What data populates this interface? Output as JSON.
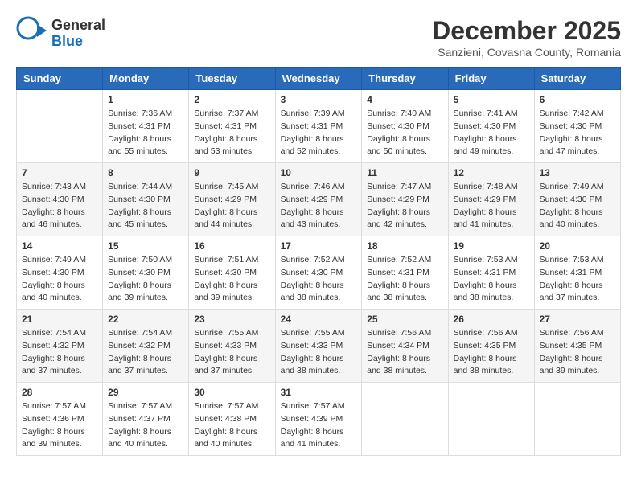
{
  "header": {
    "logo_general": "General",
    "logo_blue": "Blue",
    "month_title": "December 2025",
    "location": "Sanzieni, Covasna County, Romania"
  },
  "weekdays": [
    "Sunday",
    "Monday",
    "Tuesday",
    "Wednesday",
    "Thursday",
    "Friday",
    "Saturday"
  ],
  "weeks": [
    [
      {
        "day": "",
        "info": ""
      },
      {
        "day": "1",
        "info": "Sunrise: 7:36 AM\nSunset: 4:31 PM\nDaylight: 8 hours\nand 55 minutes."
      },
      {
        "day": "2",
        "info": "Sunrise: 7:37 AM\nSunset: 4:31 PM\nDaylight: 8 hours\nand 53 minutes."
      },
      {
        "day": "3",
        "info": "Sunrise: 7:39 AM\nSunset: 4:31 PM\nDaylight: 8 hours\nand 52 minutes."
      },
      {
        "day": "4",
        "info": "Sunrise: 7:40 AM\nSunset: 4:30 PM\nDaylight: 8 hours\nand 50 minutes."
      },
      {
        "day": "5",
        "info": "Sunrise: 7:41 AM\nSunset: 4:30 PM\nDaylight: 8 hours\nand 49 minutes."
      },
      {
        "day": "6",
        "info": "Sunrise: 7:42 AM\nSunset: 4:30 PM\nDaylight: 8 hours\nand 47 minutes."
      }
    ],
    [
      {
        "day": "7",
        "info": "Sunrise: 7:43 AM\nSunset: 4:30 PM\nDaylight: 8 hours\nand 46 minutes."
      },
      {
        "day": "8",
        "info": "Sunrise: 7:44 AM\nSunset: 4:30 PM\nDaylight: 8 hours\nand 45 minutes."
      },
      {
        "day": "9",
        "info": "Sunrise: 7:45 AM\nSunset: 4:29 PM\nDaylight: 8 hours\nand 44 minutes."
      },
      {
        "day": "10",
        "info": "Sunrise: 7:46 AM\nSunset: 4:29 PM\nDaylight: 8 hours\nand 43 minutes."
      },
      {
        "day": "11",
        "info": "Sunrise: 7:47 AM\nSunset: 4:29 PM\nDaylight: 8 hours\nand 42 minutes."
      },
      {
        "day": "12",
        "info": "Sunrise: 7:48 AM\nSunset: 4:29 PM\nDaylight: 8 hours\nand 41 minutes."
      },
      {
        "day": "13",
        "info": "Sunrise: 7:49 AM\nSunset: 4:30 PM\nDaylight: 8 hours\nand 40 minutes."
      }
    ],
    [
      {
        "day": "14",
        "info": "Sunrise: 7:49 AM\nSunset: 4:30 PM\nDaylight: 8 hours\nand 40 minutes."
      },
      {
        "day": "15",
        "info": "Sunrise: 7:50 AM\nSunset: 4:30 PM\nDaylight: 8 hours\nand 39 minutes."
      },
      {
        "day": "16",
        "info": "Sunrise: 7:51 AM\nSunset: 4:30 PM\nDaylight: 8 hours\nand 39 minutes."
      },
      {
        "day": "17",
        "info": "Sunrise: 7:52 AM\nSunset: 4:30 PM\nDaylight: 8 hours\nand 38 minutes."
      },
      {
        "day": "18",
        "info": "Sunrise: 7:52 AM\nSunset: 4:31 PM\nDaylight: 8 hours\nand 38 minutes."
      },
      {
        "day": "19",
        "info": "Sunrise: 7:53 AM\nSunset: 4:31 PM\nDaylight: 8 hours\nand 38 minutes."
      },
      {
        "day": "20",
        "info": "Sunrise: 7:53 AM\nSunset: 4:31 PM\nDaylight: 8 hours\nand 37 minutes."
      }
    ],
    [
      {
        "day": "21",
        "info": "Sunrise: 7:54 AM\nSunset: 4:32 PM\nDaylight: 8 hours\nand 37 minutes."
      },
      {
        "day": "22",
        "info": "Sunrise: 7:54 AM\nSunset: 4:32 PM\nDaylight: 8 hours\nand 37 minutes."
      },
      {
        "day": "23",
        "info": "Sunrise: 7:55 AM\nSunset: 4:33 PM\nDaylight: 8 hours\nand 37 minutes."
      },
      {
        "day": "24",
        "info": "Sunrise: 7:55 AM\nSunset: 4:33 PM\nDaylight: 8 hours\nand 38 minutes."
      },
      {
        "day": "25",
        "info": "Sunrise: 7:56 AM\nSunset: 4:34 PM\nDaylight: 8 hours\nand 38 minutes."
      },
      {
        "day": "26",
        "info": "Sunrise: 7:56 AM\nSunset: 4:35 PM\nDaylight: 8 hours\nand 38 minutes."
      },
      {
        "day": "27",
        "info": "Sunrise: 7:56 AM\nSunset: 4:35 PM\nDaylight: 8 hours\nand 39 minutes."
      }
    ],
    [
      {
        "day": "28",
        "info": "Sunrise: 7:57 AM\nSunset: 4:36 PM\nDaylight: 8 hours\nand 39 minutes."
      },
      {
        "day": "29",
        "info": "Sunrise: 7:57 AM\nSunset: 4:37 PM\nDaylight: 8 hours\nand 40 minutes."
      },
      {
        "day": "30",
        "info": "Sunrise: 7:57 AM\nSunset: 4:38 PM\nDaylight: 8 hours\nand 40 minutes."
      },
      {
        "day": "31",
        "info": "Sunrise: 7:57 AM\nSunset: 4:39 PM\nDaylight: 8 hours\nand 41 minutes."
      },
      {
        "day": "",
        "info": ""
      },
      {
        "day": "",
        "info": ""
      },
      {
        "day": "",
        "info": ""
      }
    ]
  ]
}
